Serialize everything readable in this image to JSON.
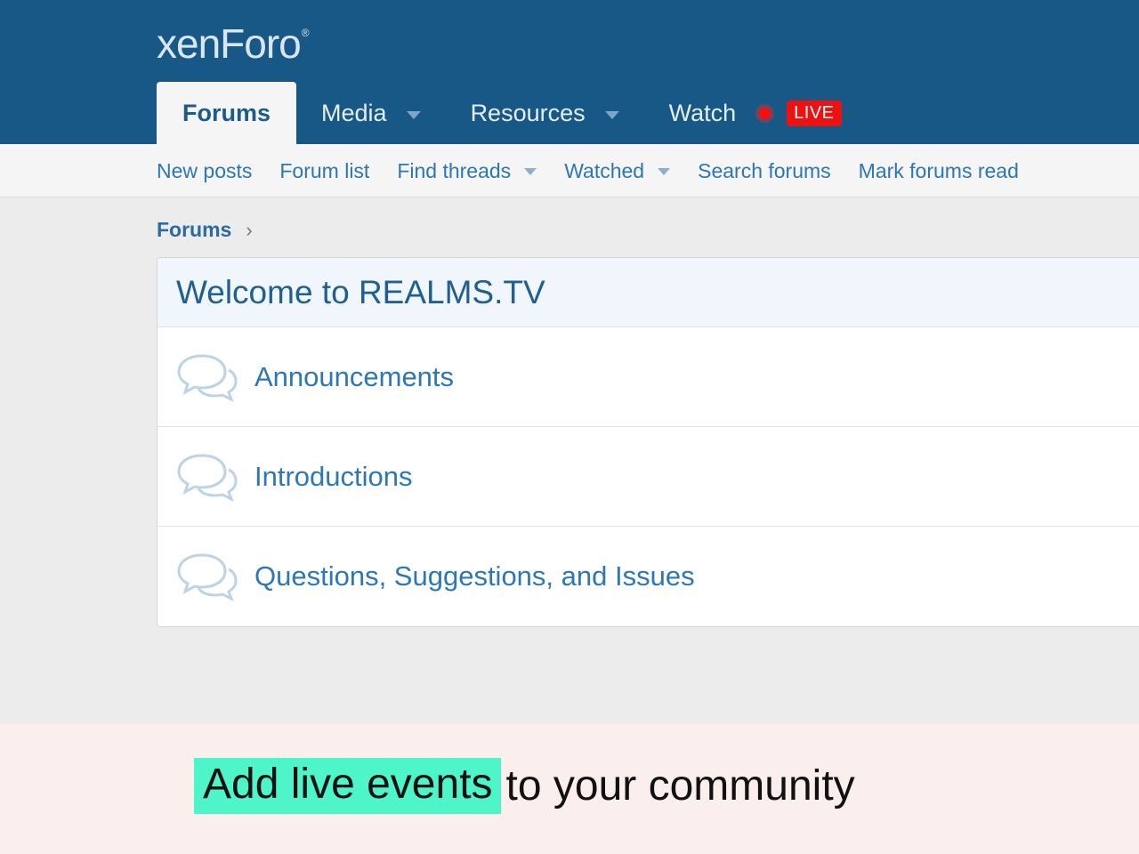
{
  "header": {
    "logo_text": "xenForo",
    "logo_mark": "®",
    "tabs": [
      {
        "label": "Forums",
        "active": true,
        "dropdown": false
      },
      {
        "label": "Media",
        "active": false,
        "dropdown": true
      },
      {
        "label": "Resources",
        "active": false,
        "dropdown": true
      },
      {
        "label": "Watch",
        "active": false,
        "dropdown": false
      }
    ],
    "live_badge": "LIVE"
  },
  "subnav": {
    "items": [
      {
        "label": "New posts",
        "dropdown": false
      },
      {
        "label": "Forum list",
        "dropdown": false
      },
      {
        "label": "Find threads",
        "dropdown": true
      },
      {
        "label": "Watched",
        "dropdown": true
      },
      {
        "label": "Search forums",
        "dropdown": false
      },
      {
        "label": "Mark forums read",
        "dropdown": false
      }
    ]
  },
  "breadcrumb": {
    "label": "Forums",
    "separator": "›"
  },
  "forum_block": {
    "title": "Welcome to REALMS.TV",
    "nodes": [
      {
        "title": "Announcements",
        "icon": "chat-bubbles-icon"
      },
      {
        "title": "Introductions",
        "icon": "chat-bubbles-icon"
      },
      {
        "title": "Questions, Suggestions, and Issues",
        "icon": "chat-bubbles-icon"
      }
    ]
  },
  "promo": {
    "highlight": "Add live events",
    "rest": "to your community"
  },
  "colors": {
    "header_bg": "#185886",
    "link": "#2c77b3",
    "live_red": "#ee1111",
    "highlight": "#4ef5c8",
    "promo_bg": "#faefed"
  }
}
